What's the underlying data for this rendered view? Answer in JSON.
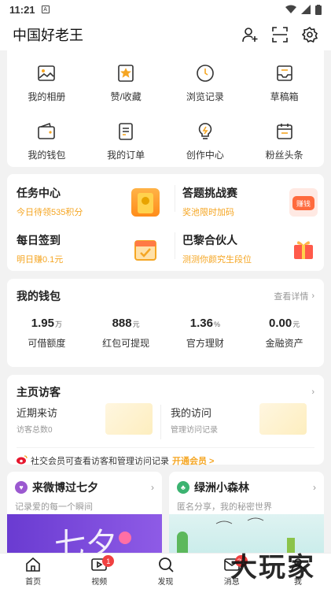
{
  "status_bar": {
    "time": "11:21",
    "notif_icon": "A"
  },
  "header": {
    "title": "中国好老王"
  },
  "grid": [
    {
      "label": "我的相册",
      "icon": "photo-album-icon"
    },
    {
      "label": "赞/收藏",
      "icon": "like-collect-icon"
    },
    {
      "label": "浏览记录",
      "icon": "history-clock-icon"
    },
    {
      "label": "草稿箱",
      "icon": "drafts-icon"
    },
    {
      "label": "我的钱包",
      "icon": "wallet-icon"
    },
    {
      "label": "我的订单",
      "icon": "order-icon"
    },
    {
      "label": "创作中心",
      "icon": "creator-bulb-icon"
    },
    {
      "label": "粉丝头条",
      "icon": "fans-headline-icon"
    }
  ],
  "tasks": [
    {
      "title": "任务中心",
      "sub": "今日待领535积分"
    },
    {
      "title": "答题挑战赛",
      "sub": "奖池限时加码",
      "img_label": "赚钱"
    },
    {
      "title": "每日签到",
      "sub": "明日赚0.1元"
    },
    {
      "title": "巴黎合伙人",
      "sub": "测测你颜究生段位"
    }
  ],
  "wallet": {
    "title": "我的钱包",
    "more": "查看详情",
    "stats": [
      {
        "value": "1.95",
        "unit": "万",
        "label": "可借额度"
      },
      {
        "value": "888",
        "unit": "元",
        "label": "红包可提现"
      },
      {
        "value": "1.36",
        "unit": "%",
        "label": "官方理财"
      },
      {
        "value": "0.00",
        "unit": "元",
        "label": "金融资产"
      }
    ]
  },
  "visitors": {
    "title": "主页访客",
    "left_title": "近期来访",
    "left_sub": "访客总数0",
    "right_title": "我的访问",
    "right_sub": "管理访问记录",
    "vip_text": "社交会员可查看访客和管理访问记录",
    "vip_link": "开通会员 >"
  },
  "promos": [
    {
      "name": "来微博过七夕",
      "sub": "记录爱的每一个瞬间",
      "color": "#9b59d0"
    },
    {
      "name": "绿洲小森林",
      "sub": "匿名分享，我的秘密世界",
      "color": "#3cb371"
    }
  ],
  "tabs": [
    {
      "label": "首页",
      "icon": "home-icon",
      "badge": ""
    },
    {
      "label": "视频",
      "icon": "video-icon",
      "badge": "1"
    },
    {
      "label": "发现",
      "icon": "search-icon",
      "badge": ""
    },
    {
      "label": "消息",
      "icon": "message-icon",
      "badge": "31"
    },
    {
      "label": "我",
      "icon": "profile-icon",
      "badge": ""
    }
  ],
  "watermark": "大玩家"
}
